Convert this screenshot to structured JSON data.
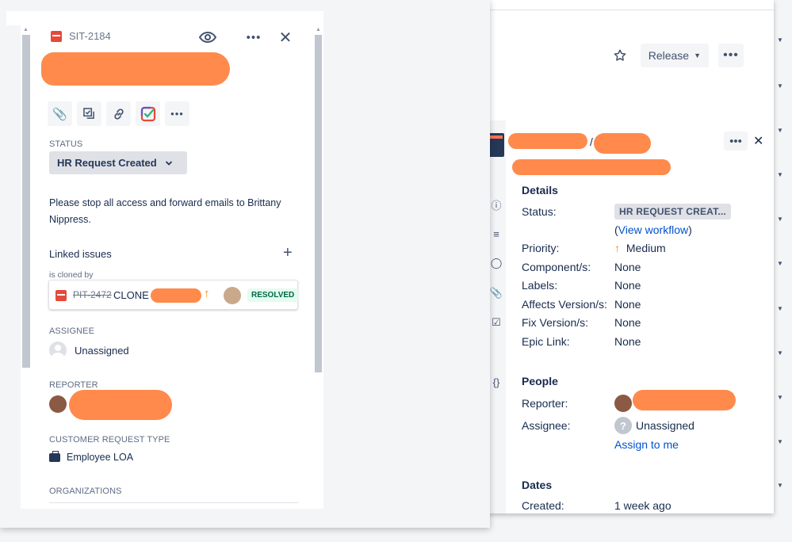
{
  "colors": {
    "accent_link": "#0052cc",
    "redaction": "#ff8a4c",
    "resolved_bg": "#e3fcef",
    "resolved_text": "#006644",
    "priority_medium": "#ff8b00",
    "bug_red": "#e5493a"
  },
  "front": {
    "issue_key": "SIT-2184",
    "header_icons": [
      "watch-eye-icon",
      "more-icon",
      "close-icon"
    ],
    "toolbar_icons": [
      "attachment-icon",
      "subtask-icon",
      "link-icon",
      "checklist-app-icon",
      "more-icon"
    ],
    "status_label": "STATUS",
    "status_value": "HR Request Created",
    "description": "Please stop all access and forward emails to Brittany Nippress.",
    "linked_issues_heading": "Linked issues",
    "link_type": "is cloned by",
    "linked_issue": {
      "key": "PIT-2472",
      "summary": "CLONE -",
      "status": "RESOLVED"
    },
    "assignee_label": "ASSIGNEE",
    "assignee_value": "Unassigned",
    "reporter_label": "REPORTER",
    "crt_label": "CUSTOMER REQUEST TYPE",
    "crt_value": "Employee LOA",
    "org_label": "ORGANIZATIONS"
  },
  "back": {
    "release_label": "Release",
    "slash": "/",
    "details_heading": "Details",
    "fields": [
      {
        "label": "Status:",
        "value": "HR REQUEST CREAT..."
      },
      {
        "label": "Priority:",
        "value": "Medium"
      },
      {
        "label": "Component/s:",
        "value": "None"
      },
      {
        "label": "Labels:",
        "value": "None"
      },
      {
        "label": "Affects Version/s:",
        "value": "None"
      },
      {
        "label": "Fix Version/s:",
        "value": "None"
      },
      {
        "label": "Epic Link:",
        "value": "None"
      }
    ],
    "view_workflow_open": "(",
    "view_workflow": "View workflow",
    "view_workflow_close": ")",
    "people_heading": "People",
    "reporter_label": "Reporter:",
    "assignee_label": "Assignee:",
    "assignee_value": "Unassigned",
    "assign_to_me": "Assign to me",
    "dates_heading": "Dates",
    "created_label": "Created:",
    "created_value": "1 week ago"
  }
}
